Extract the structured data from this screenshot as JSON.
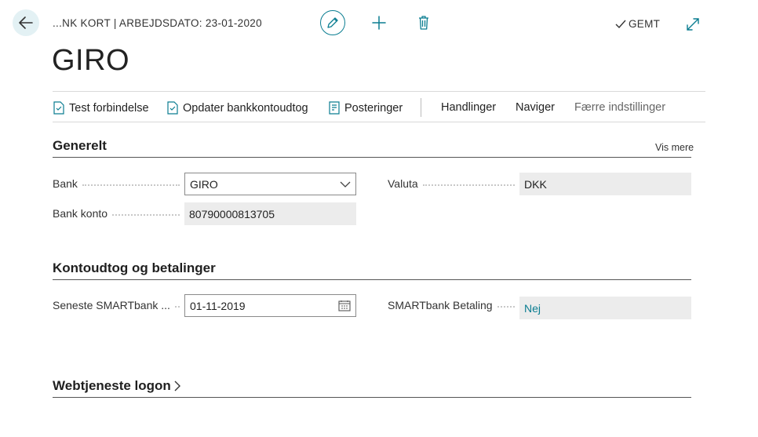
{
  "header": {
    "breadcrumb": "...NK KORT | ARBEJDSDATO: 23-01-2020",
    "title": "GIRO",
    "saved_label": "GEMT"
  },
  "actions": {
    "test_connection": "Test forbindelse",
    "update_statement": "Opdater bankkontoudtog",
    "entries": "Posteringer",
    "handlinger": "Handlinger",
    "naviger": "Naviger",
    "fewer_options": "Færre indstillinger"
  },
  "general": {
    "title": "Generelt",
    "show_more": "Vis mere",
    "bank_label": "Bank",
    "bank_value": "GIRO",
    "valuta_label": "Valuta",
    "valuta_value": "DKK",
    "bank_account_label": "Bank konto",
    "bank_account_value": "80790000813705"
  },
  "statements": {
    "title": "Kontoudtog og betalinger",
    "latest_label": "Seneste SMARTbank ...",
    "latest_value": "01-11-2019",
    "payment_label": "SMARTbank Betaling",
    "payment_value": "Nej"
  },
  "webservice": {
    "title": "Webtjeneste logon"
  },
  "colors": {
    "accent": "#0a7d91",
    "back_bg": "#e3f1f4",
    "readonly_bg": "#ececec"
  }
}
